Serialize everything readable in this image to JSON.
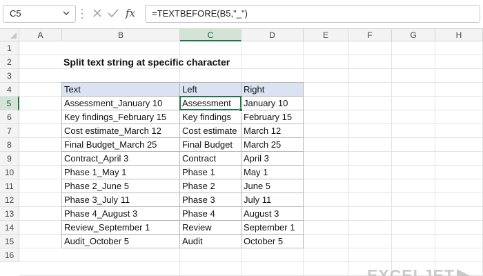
{
  "formula_bar": {
    "name_box": "C5",
    "fx_label": "fx",
    "formula": "=TEXTBEFORE(B5,\"_\")"
  },
  "columns": [
    "A",
    "B",
    "C",
    "D",
    "E",
    "F",
    "G",
    "H"
  ],
  "rows": [
    "1",
    "2",
    "3",
    "4",
    "5",
    "6",
    "7",
    "8",
    "9",
    "10",
    "11",
    "12",
    "13",
    "14",
    "15",
    "16"
  ],
  "active_cell": {
    "column": "C",
    "row": "5"
  },
  "sheet": {
    "title": "Split text string at specific character",
    "table": {
      "headers": [
        "Text",
        "Left",
        "Right"
      ],
      "rows": [
        [
          "Assessment_January 10",
          "Assessment",
          "January 10"
        ],
        [
          "Key findings_February 15",
          "Key findings",
          "February 15"
        ],
        [
          "Cost estimate_March 12",
          "Cost estimate",
          "March 12"
        ],
        [
          "Final Budget_March 25",
          "Final Budget",
          "March 25"
        ],
        [
          "Contract_April 3",
          "Contract",
          "April 3"
        ],
        [
          "Phase 1_May 1",
          "Phase 1",
          "May 1"
        ],
        [
          "Phase 2_June 5",
          "Phase 2",
          "June 5"
        ],
        [
          "Phase 3_July 11",
          "Phase 3",
          "July 11"
        ],
        [
          "Phase 4_August 3",
          "Phase 4",
          "August 3"
        ],
        [
          "Review_September 1",
          "Review",
          "September 1"
        ],
        [
          "Audit_October 5",
          "Audit",
          "October 5"
        ]
      ]
    }
  },
  "brand": {
    "logo_text": "EXCELJET"
  },
  "colors": {
    "accent": "#217346",
    "header_fill": "#dbe3f3",
    "logo": "#c9c9c9"
  }
}
